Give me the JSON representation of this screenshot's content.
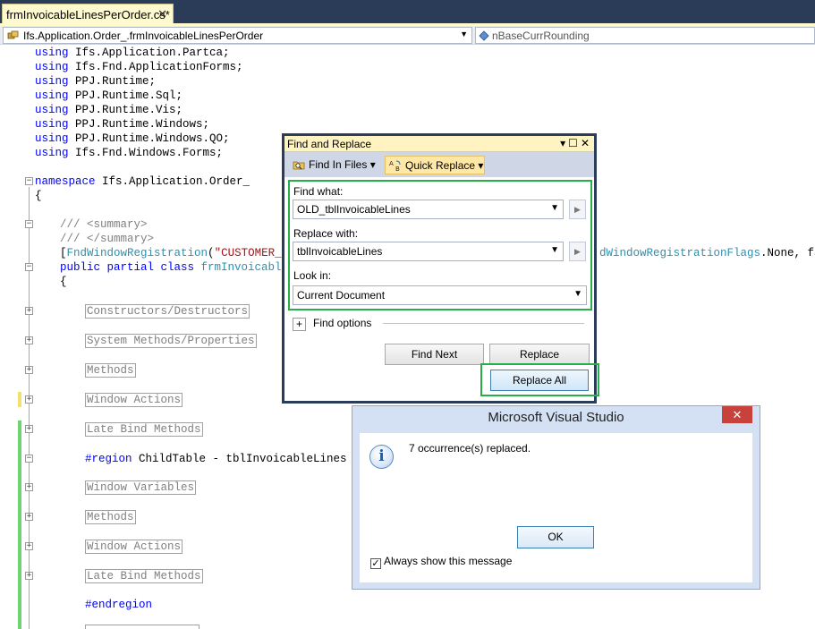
{
  "tab": {
    "title": "frmInvoicableLinesPerOrder.cs*",
    "close_glyph": "✕"
  },
  "navbar": {
    "type_combo": "Ifs.Application.Order_.frmInvoicableLinesPerOrder",
    "member_combo": "nBaseCurrRounding"
  },
  "code": {
    "usings": [
      {
        "kw": "using",
        "ns": " Ifs.Application.Partca;"
      },
      {
        "kw": "using",
        "ns": " Ifs.Fnd.ApplicationForms;"
      },
      {
        "kw": "using",
        "ns": " PPJ.Runtime;"
      },
      {
        "kw": "using",
        "ns": " PPJ.Runtime.Sql;"
      },
      {
        "kw": "using",
        "ns": " PPJ.Runtime.Vis;"
      },
      {
        "kw": "using",
        "ns": " PPJ.Runtime.Windows;"
      },
      {
        "kw": "using",
        "ns": " PPJ.Runtime.Windows.QO;"
      },
      {
        "kw": "using",
        "ns": " Ifs.Fnd.Windows.Forms;"
      }
    ],
    "namespace_kw": "namespace",
    "namespace_name": " Ifs.Application.Order_",
    "open_brace": "{",
    "summary_open": "/// <summary>",
    "summary_close": "/// </summary>",
    "attr_open": "[",
    "attr_type": "FndWindowRegistration",
    "attr_paren": "(",
    "attr_string": "\"CUSTOMER_OR",
    "attr_tail_type": "dWindowRegistrationFlags",
    "attr_tail_rest": ".None, fals",
    "class_mods": "public partial class",
    "class_name": " frmInvoicableLi",
    "class_brace": "{",
    "regions1": [
      "Constructors/Destructors",
      "System Methods/Properties",
      "Methods",
      "Window Actions",
      "Late Bind Methods"
    ],
    "region_kw": "#region",
    "region_name": " ChildTable - tblInvoicableLines",
    "regions2": [
      "Window Variables",
      "Methods",
      "Window Actions",
      "Late Bind Methods"
    ],
    "endregion": "#endregion"
  },
  "find_replace": {
    "title": "Find and Replace",
    "find_in_files": "Find In Files",
    "quick_replace": "Quick Replace",
    "find_what_label": "Find what:",
    "find_what_value": "OLD_tblInvoicableLines",
    "replace_with_label": "Replace with:",
    "replace_with_value": "tblInvoicableLines",
    "look_in_label": "Look in:",
    "look_in_value": "Current Document",
    "find_options_label": "Find options",
    "find_next": "Find Next",
    "replace": "Replace",
    "replace_all": "Replace All"
  },
  "message_box": {
    "title": "Microsoft Visual Studio",
    "message": "7 occurrence(s) replaced.",
    "ok": "OK",
    "checkbox_label": "Always show this message",
    "checkbox_checked": true
  },
  "colors": {
    "keyword": "#0000ff",
    "type": "#2b91af",
    "string": "#a31515",
    "comment": "#808080",
    "highlight_green": "#27ae48",
    "tab_active": "#fffacd"
  }
}
